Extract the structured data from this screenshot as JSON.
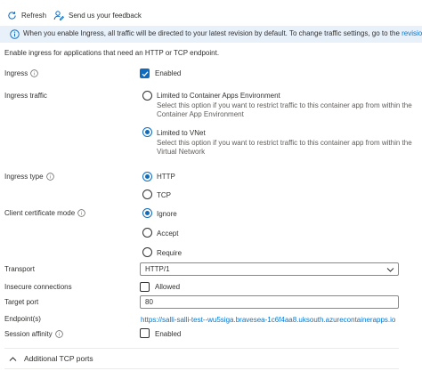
{
  "toolbar": {
    "refresh_label": "Refresh",
    "feedback_label": "Send us your feedback"
  },
  "info_bar": {
    "text": "When you enable Ingress, all traffic will be directed to your latest revision by default. To change traffic settings, go to the",
    "link_text": "revision"
  },
  "intro_text": "Enable ingress for applications that need an HTTP or TCP endpoint.",
  "ingress": {
    "label": "Ingress",
    "checkbox_label": "Enabled",
    "checked": true
  },
  "ingress_traffic": {
    "label": "Ingress traffic",
    "options": [
      {
        "label": "Limited to Container Apps Environment",
        "description": "Select this option if you want to restrict traffic to this container app from within the Container App Environment",
        "selected": false
      },
      {
        "label": "Limited to VNet",
        "description": "Select this option if you want to restrict traffic to this container app from within the Virtual Network",
        "selected": true
      }
    ]
  },
  "ingress_type": {
    "label": "Ingress type",
    "options": [
      {
        "label": "HTTP",
        "selected": true
      },
      {
        "label": "TCP",
        "selected": false
      }
    ]
  },
  "client_cert": {
    "label": "Client certificate mode",
    "options": [
      {
        "label": "Ignore",
        "selected": true
      },
      {
        "label": "Accept",
        "selected": false
      },
      {
        "label": "Require",
        "selected": false
      }
    ]
  },
  "transport": {
    "label": "Transport",
    "value": "HTTP/1"
  },
  "insecure": {
    "label": "Insecure connections",
    "checkbox_label": "Allowed",
    "checked": false
  },
  "target_port": {
    "label": "Target port",
    "value": "80"
  },
  "endpoints": {
    "label": "Endpoint(s)",
    "url": "https://salli-salli-test--wu5siga.bravesea-1c6f4aa8.uksouth.azurecontainerapps.io"
  },
  "session_affinity": {
    "label": "Session affinity",
    "checkbox_label": "Enabled",
    "checked": false
  },
  "additional_tcp": {
    "title": "Additional TCP ports"
  },
  "colors": {
    "accent": "#0f6cbd",
    "link": "#0078d4",
    "info_bg": "#e8f0fa"
  }
}
